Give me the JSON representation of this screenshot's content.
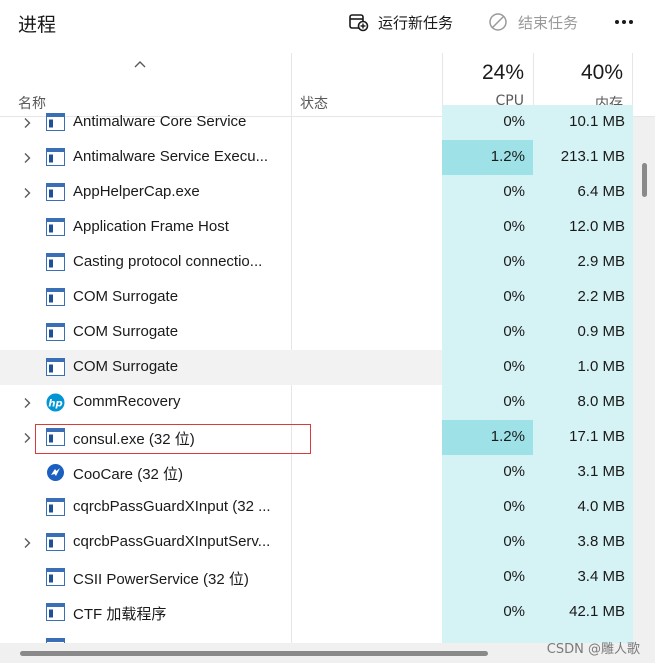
{
  "toolbar": {
    "title": "进程",
    "run_task_label": "运行新任务",
    "end_task_label": "结束任务"
  },
  "header": {
    "name_label": "名称",
    "status_label": "状态",
    "cpu_pct": "24%",
    "cpu_label": "CPU",
    "mem_pct": "40%",
    "mem_label": "内存"
  },
  "rows": [
    {
      "name": "Antimalware Core Service",
      "cpu": "0%",
      "mem": "10.1 MB",
      "expandable": true,
      "icon": "app-window-icon"
    },
    {
      "name": "Antimalware Service Execu...",
      "cpu": "1.2%",
      "mem": "213.1 MB",
      "expandable": true,
      "icon": "app-window-icon"
    },
    {
      "name": "AppHelperCap.exe",
      "cpu": "0%",
      "mem": "6.4 MB",
      "expandable": true,
      "icon": "app-window-icon"
    },
    {
      "name": "Application Frame Host",
      "cpu": "0%",
      "mem": "12.0 MB",
      "expandable": false,
      "icon": "app-window-icon"
    },
    {
      "name": "Casting protocol connectio...",
      "cpu": "0%",
      "mem": "2.9 MB",
      "expandable": false,
      "icon": "app-window-icon"
    },
    {
      "name": "COM Surrogate",
      "cpu": "0%",
      "mem": "2.2 MB",
      "expandable": false,
      "icon": "app-window-icon"
    },
    {
      "name": "COM Surrogate",
      "cpu": "0%",
      "mem": "0.9 MB",
      "expandable": false,
      "icon": "app-window-icon"
    },
    {
      "name": "COM Surrogate",
      "cpu": "0%",
      "mem": "1.0 MB",
      "expandable": false,
      "icon": "app-window-icon"
    },
    {
      "name": "CommRecovery",
      "cpu": "0%",
      "mem": "8.0 MB",
      "expandable": true,
      "icon": "hp-logo-icon"
    },
    {
      "name": "consul.exe (32 位)",
      "cpu": "1.2%",
      "mem": "17.1 MB",
      "expandable": true,
      "icon": "app-window-icon"
    },
    {
      "name": "CooCare (32 位)",
      "cpu": "0%",
      "mem": "3.1 MB",
      "expandable": false,
      "icon": "coocare-icon"
    },
    {
      "name": "cqrcbPassGuardXInput (32 ...",
      "cpu": "0%",
      "mem": "4.0 MB",
      "expandable": false,
      "icon": "app-window-icon"
    },
    {
      "name": "cqrcbPassGuardXInputServ...",
      "cpu": "0%",
      "mem": "3.8 MB",
      "expandable": true,
      "icon": "app-window-icon"
    },
    {
      "name": "CSII PowerService (32 位)",
      "cpu": "0%",
      "mem": "3.4 MB",
      "expandable": false,
      "icon": "app-window-icon"
    },
    {
      "name": "CTF 加载程序",
      "cpu": "0%",
      "mem": "42.1 MB",
      "expandable": false,
      "icon": "app-window-icon"
    },
    {
      "name": "",
      "cpu": "",
      "mem": "",
      "expandable": false,
      "icon": "app-window-icon"
    }
  ],
  "watermark": "CSDN @雕人歌",
  "colors": {
    "cpu_cell": "#d5f2f4",
    "cpu_cell_hot": "#9ee1e6",
    "highlight_box": "#d93b3b"
  }
}
